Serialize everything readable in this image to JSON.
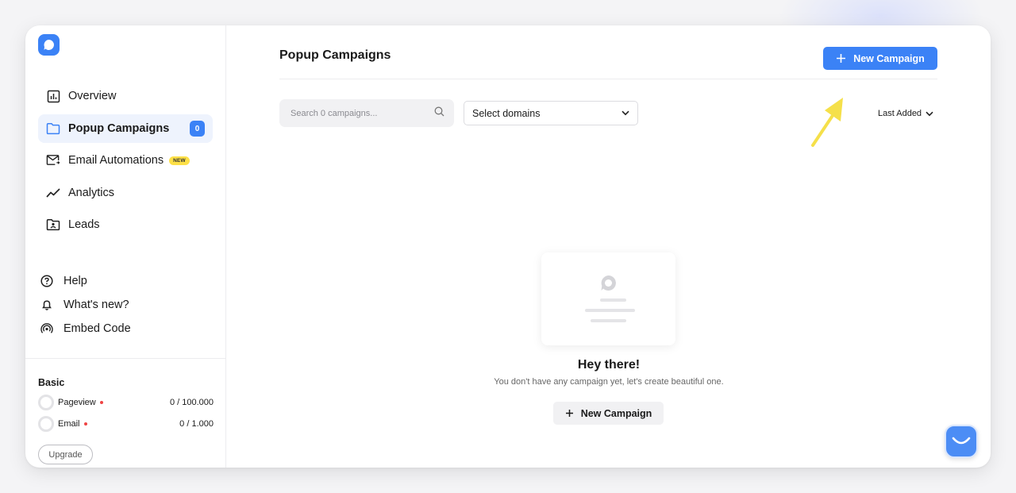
{
  "sidebar": {
    "nav": [
      {
        "label": "Overview",
        "icon": "chart-bar-icon"
      },
      {
        "label": "Popup Campaigns",
        "icon": "folder-icon",
        "count": "0"
      },
      {
        "label": "Email Automations",
        "icon": "mail-icon",
        "badge": "NEW"
      },
      {
        "label": "Analytics",
        "icon": "trend-line-icon"
      },
      {
        "label": "Leads",
        "icon": "folder-user-icon"
      }
    ],
    "secondary": [
      {
        "label": "Help",
        "icon": "help-circle-icon"
      },
      {
        "label": "What's new?",
        "icon": "bell-icon"
      },
      {
        "label": "Embed Code",
        "icon": "broadcast-icon"
      }
    ],
    "plan": {
      "name": "Basic",
      "usage": [
        {
          "label": "Pageview",
          "value": "0 / 100.000"
        },
        {
          "label": "Email",
          "value": "0 / 1.000"
        }
      ],
      "upgrade_label": "Upgrade"
    }
  },
  "main": {
    "title": "Popup Campaigns",
    "new_campaign_label": "New Campaign",
    "search_placeholder": "Search 0 campaigns...",
    "domains_select": "Select domains",
    "sort_label": "Last Added",
    "empty": {
      "title": "Hey there!",
      "subtitle": "You don't have any campaign yet, let's create beautiful one.",
      "button_label": "New Campaign"
    }
  },
  "colors": {
    "accent": "#3b82f6",
    "active_bg": "#eef3fd",
    "new_badge": "#fde047",
    "arrow": "#f5e04a"
  }
}
